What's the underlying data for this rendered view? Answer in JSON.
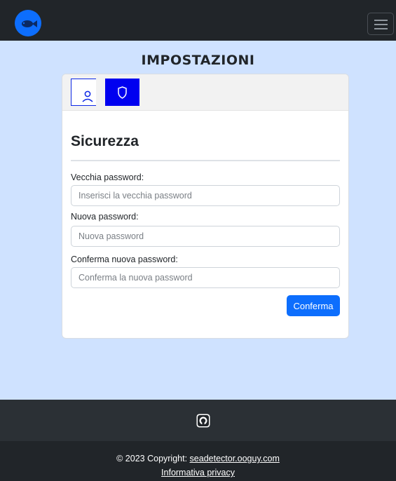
{
  "navbar": {
    "logo_icon": "fish-logo-icon",
    "menu_icon": "hamburger-menu-icon"
  },
  "page": {
    "title": "IMPOSTAZIONI"
  },
  "tabs": {
    "profile_icon": "user-icon",
    "security_icon": "shield-icon",
    "active": "security"
  },
  "security": {
    "heading": "Sicurezza",
    "old_password": {
      "label": "Vecchia password:",
      "placeholder": "Inserisci la vecchia password"
    },
    "new_password": {
      "label": "Nuova password:",
      "placeholder": "Nuova password"
    },
    "confirm_password": {
      "label": "Conferma nuova password:",
      "placeholder": "Conferma la nuova password"
    },
    "confirm_button": "Conferma"
  },
  "footer": {
    "github_icon": "github-icon",
    "copyright_prefix": "© 2023 Copyright: ",
    "copyright_link": "seadetector.ooguy.com",
    "privacy_link": "Informativa privacy"
  },
  "colors": {
    "accent": "#0d6efd",
    "active_tab": "#0000f0",
    "page_background": "#cfe2ff",
    "navbar": "#212529"
  }
}
